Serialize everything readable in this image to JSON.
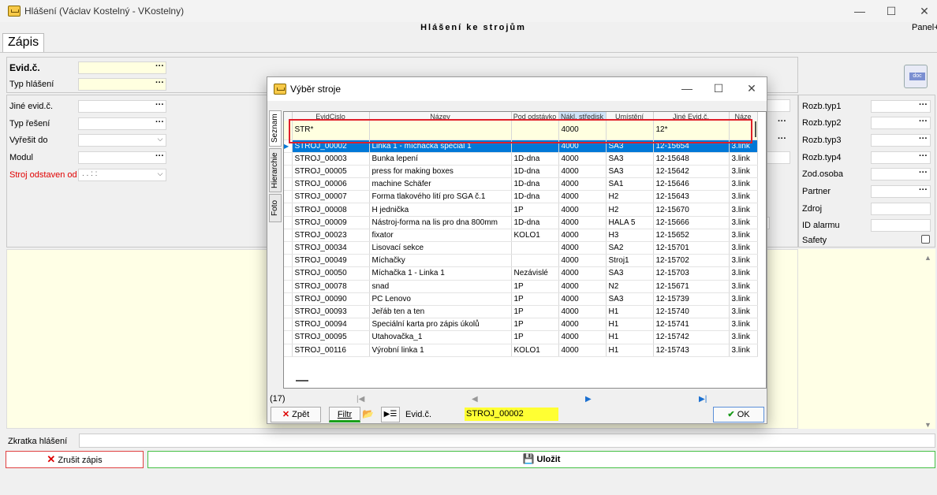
{
  "window": {
    "title": "Hlášení (Václav Kostelný - VKostelny)",
    "center_title": "Hlášení ke strojům",
    "panel_plus": "Panel+",
    "controls": [
      "—",
      "☐",
      "✕"
    ]
  },
  "tab": {
    "label": "Zápis"
  },
  "form_left": {
    "evid": "Evid.č.",
    "typ": "Typ hlášení",
    "jine": "Jiné evid.č.",
    "typreseni": "Typ řešení",
    "vyresit": "Vyřešit do",
    "modul": "Modul",
    "stroj": "Stroj odstaven od",
    "stroj_value": " .  .    :  :"
  },
  "form_right": {
    "labels": [
      "Rozb.typ1",
      "Rozb.typ2",
      "Rozb.typ3",
      "Rozb.typ4",
      "Zod.osoba",
      "Partner",
      "Zdroj",
      "ID alarmu",
      "Safety"
    ]
  },
  "dialog": {
    "title": "Výběr stroje",
    "side_tabs": [
      "Seznam",
      "Hierarchie",
      "Foto"
    ],
    "columns": [
      "EvidCislo",
      "Název",
      "Pod odstávko",
      "Nákl. středisk",
      "Umístění",
      "Jiné Evid.č.",
      "Náze"
    ],
    "filter": [
      "STR*",
      "",
      "",
      "4000",
      "",
      "12*",
      ""
    ],
    "rows": [
      [
        "STROJ_00002",
        "Linka 1 - míchačka speciál 1",
        "",
        "4000",
        "SA3",
        "12-15654",
        "3.link"
      ],
      [
        "STROJ_00003",
        "Bunka lepení",
        "1D-dna",
        "4000",
        "SA3",
        "12-15648",
        "3.link"
      ],
      [
        "STROJ_00005",
        "press for making boxes",
        "1D-dna",
        "4000",
        "SA3",
        "12-15642",
        "3.link"
      ],
      [
        "STROJ_00006",
        "machine Schäfer",
        "1D-dna",
        "4000",
        "SA1",
        "12-15646",
        "3.link"
      ],
      [
        "STROJ_00007",
        "Forma tlakového lití pro SGA č.1",
        "1D-dna",
        "4000",
        "H2",
        "12-15643",
        "3.link"
      ],
      [
        "STROJ_00008",
        "H jednička",
        "1P",
        "4000",
        "H2",
        "12-15670",
        "3.link"
      ],
      [
        "STROJ_00009",
        "Nástroj-forma na lis pro dna 800mm",
        "1D-dna",
        "4000",
        "HALA 5",
        "12-15666",
        "3.link"
      ],
      [
        "STROJ_00023",
        "fixator",
        "KOLO1",
        "4000",
        "H3",
        "12-15652",
        "3.link"
      ],
      [
        "STROJ_00034",
        "Lisovací sekce",
        "",
        "4000",
        "SA2",
        "12-15701",
        "3.link"
      ],
      [
        "STROJ_00049",
        "Míchačky",
        "",
        "4000",
        "Stroj1",
        "12-15702",
        "3.link"
      ],
      [
        "STROJ_00050",
        "Míchačka 1 - Linka 1",
        "Nezávislé",
        "4000",
        "SA3",
        "12-15703",
        "3.link"
      ],
      [
        "STROJ_00078",
        "snad",
        "1P",
        "4000",
        "N2",
        "12-15671",
        "3.link"
      ],
      [
        "STROJ_00090",
        "PC Lenovo",
        "1P",
        "4000",
        "SA3",
        "12-15739",
        "3.link"
      ],
      [
        "STROJ_00093",
        "Jeřáb ten a ten",
        "1P",
        "4000",
        "H1",
        "12-15740",
        "3.link"
      ],
      [
        "STROJ_00094",
        "Speciální karta pro zápis úkolů",
        "1P",
        "4000",
        "H1",
        "12-15741",
        "3.link"
      ],
      [
        "STROJ_00095",
        "Utahovačka_1",
        "1P",
        "4000",
        "H1",
        "12-15742",
        "3.link"
      ],
      [
        "STROJ_00116",
        "Výrobní linka 1",
        "KOLO1",
        "4000",
        "H1",
        "12-15743",
        "3.link"
      ]
    ],
    "count": "(17)",
    "zpet": "Zpět",
    "filtr": "Filtr",
    "evid_label": "Evid.č.",
    "evid_value": "STROJ_00002",
    "ok": "OK"
  },
  "bottom": {
    "zkratka": "Zkratka hlášení",
    "zrusit": "Zrušit zápis",
    "ulozit": "Uložit"
  },
  "colors": {
    "selection": "#0078d7",
    "highlight_yellow": "#ffff33",
    "red_box": "#e0202a",
    "ok_green": "#1a9a1a"
  }
}
